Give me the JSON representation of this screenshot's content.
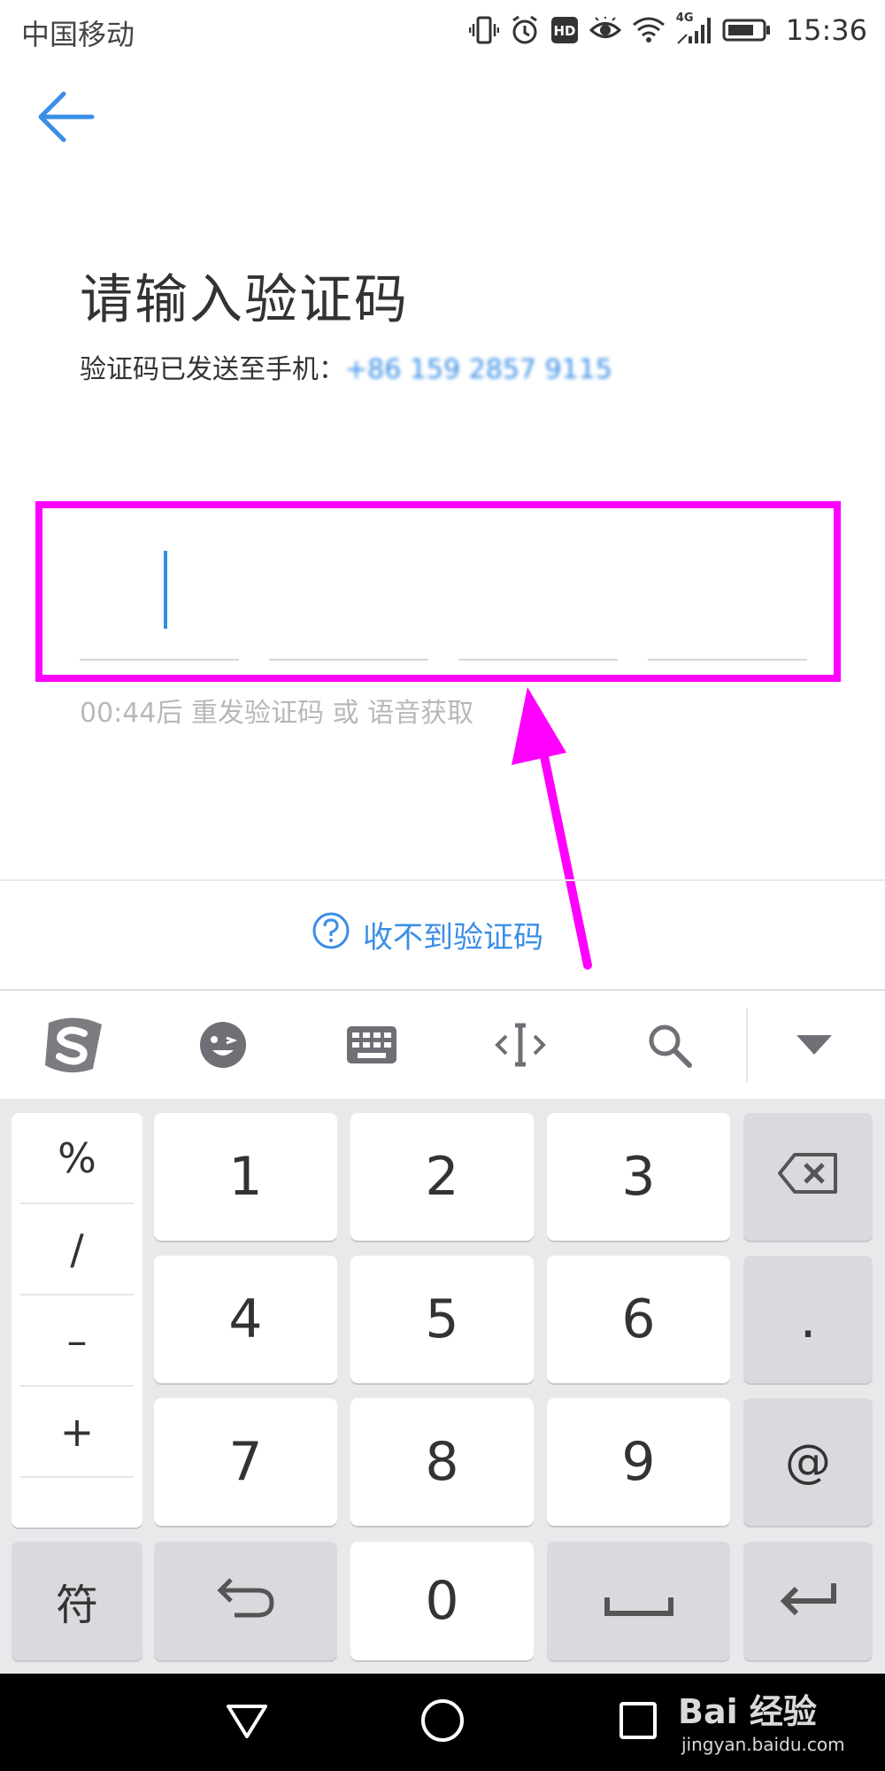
{
  "status_bar": {
    "carrier": "中国移动",
    "network_label": "4G",
    "time": "15:36"
  },
  "page": {
    "title": "请输入验证码",
    "subtitle_prefix": "验证码已发送至手机：",
    "phone_masked": "+86 159 2857 9115",
    "resend_text": "00:44后 重发验证码 或 语音获取",
    "help_link": "收不到验证码"
  },
  "keyboard": {
    "symbols": [
      "%",
      "/",
      "–",
      "+"
    ],
    "digits": [
      "1",
      "2",
      "3",
      "4",
      "5",
      "6",
      "7",
      "8",
      "9"
    ],
    "zero": "0",
    "side_keys": [
      ".",
      "@"
    ],
    "fu_label": "符"
  },
  "watermark": {
    "brand": "Bai 经验",
    "url": "jingyan.baidu.com"
  },
  "colors": {
    "accent": "#3a8ee6",
    "annotation": "#ff00ff",
    "cursor": "#2e8ee8"
  },
  "icons": [
    "back-arrow-icon",
    "vibrate-icon",
    "alarm-icon",
    "hd-icon",
    "eye-icon",
    "wifi-icon",
    "signal-icon",
    "battery-icon",
    "sogou-logo-icon",
    "emoji-icon",
    "keyboard-icon",
    "text-cursor-icon",
    "search-icon",
    "collapse-icon",
    "help-icon",
    "backspace-icon",
    "undo-icon",
    "space-icon",
    "enter-icon",
    "back-nav-icon",
    "home-nav-icon",
    "recents-nav-icon"
  ]
}
